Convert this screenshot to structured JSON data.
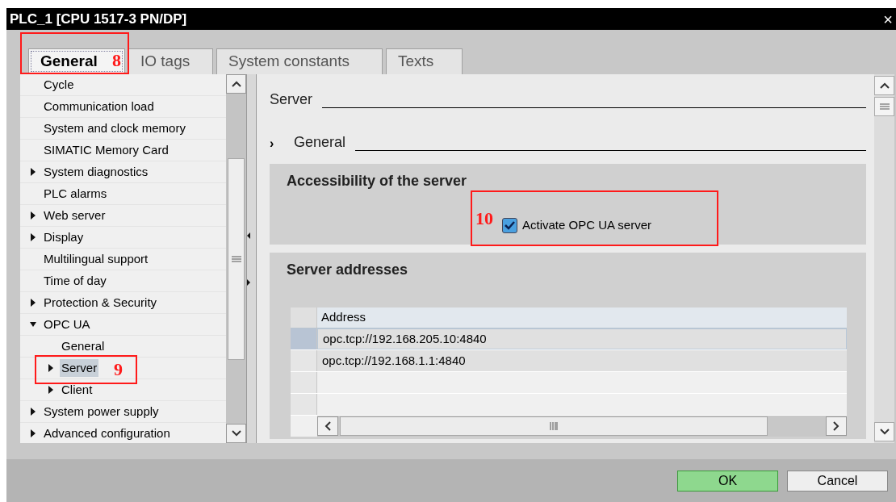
{
  "window": {
    "title": "PLC_1 [CPU 1517-3 PN/DP]",
    "close": "×"
  },
  "tabs": [
    {
      "label": "General",
      "selected": true
    },
    {
      "label": "IO tags",
      "selected": false
    },
    {
      "label": "System constants",
      "selected": false
    },
    {
      "label": "Texts",
      "selected": false
    }
  ],
  "tree": [
    {
      "label": "Cycle",
      "selected": false
    },
    {
      "label": "Communication load",
      "selected": false
    },
    {
      "label": "System and clock memory",
      "selected": false
    },
    {
      "label": "SIMATIC Memory Card",
      "selected": false
    },
    {
      "label": "System diagnostics",
      "selected": false,
      "expanded": false
    },
    {
      "label": "PLC alarms",
      "selected": false
    },
    {
      "label": "Web server",
      "selected": false,
      "expanded": false
    },
    {
      "label": "Display",
      "selected": false,
      "expanded": false
    },
    {
      "label": "Multilingual support",
      "selected": false
    },
    {
      "label": "Time of day",
      "selected": false
    },
    {
      "label": "Protection & Security",
      "selected": false,
      "expanded": false
    },
    {
      "label": "OPC UA",
      "selected": false,
      "expanded": true,
      "children": [
        {
          "label": "General",
          "selected": false
        },
        {
          "label": "Server",
          "selected": true,
          "expanded": false
        },
        {
          "label": "Client",
          "selected": false,
          "expanded": false
        }
      ]
    },
    {
      "label": "System power supply",
      "selected": false,
      "expanded": false
    },
    {
      "label": "Advanced configuration",
      "selected": false,
      "expanded": false
    }
  ],
  "content": {
    "heading": "Server",
    "subheading_marker": "›",
    "subheading": "General",
    "accessibility": {
      "title": "Accessibility of the server",
      "checkbox": {
        "label": "Activate OPC UA server",
        "checked": true
      }
    },
    "addresses": {
      "title": "Server addresses",
      "column": "Address",
      "rows": [
        {
          "value": "opc.tcp://192.168.205.10:4840",
          "selected": true
        },
        {
          "value": "opc.tcp://192.168.1.1:4840",
          "selected": false
        }
      ]
    }
  },
  "buttons": [
    {
      "label": "OK",
      "kind": "primary"
    },
    {
      "label": "Cancel",
      "kind": "secondary"
    }
  ],
  "annotations": [
    {
      "label": "8"
    },
    {
      "label": "9"
    },
    {
      "label": "10"
    }
  ]
}
